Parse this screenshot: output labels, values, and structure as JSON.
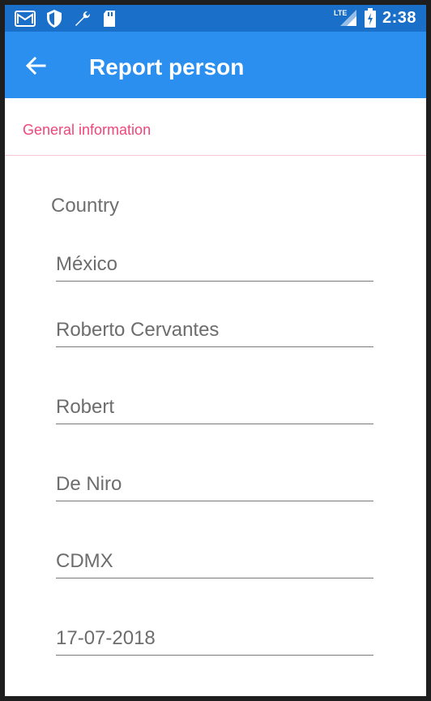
{
  "status_bar": {
    "time": "2:38",
    "network": "LTE",
    "icons": [
      "gmail-icon",
      "shield-icon",
      "wrench-icon",
      "sd-card-icon"
    ]
  },
  "app_bar": {
    "title": "Report person",
    "back_icon": "arrow-left-icon"
  },
  "section": {
    "label": "General information"
  },
  "form": {
    "country_label": "Country",
    "fields": [
      {
        "name": "country-field",
        "value": "México"
      },
      {
        "name": "full-name-field",
        "value": "Roberto Cervantes"
      },
      {
        "name": "first-name-field",
        "value": "Robert"
      },
      {
        "name": "last-name-field",
        "value": "De Niro"
      },
      {
        "name": "city-field",
        "value": "CDMX"
      },
      {
        "name": "date-field",
        "value": "17-07-2018"
      }
    ]
  },
  "colors": {
    "status_bar": "#1a6fc9",
    "app_bar": "#2b8ff0",
    "accent": "#f0467b"
  }
}
